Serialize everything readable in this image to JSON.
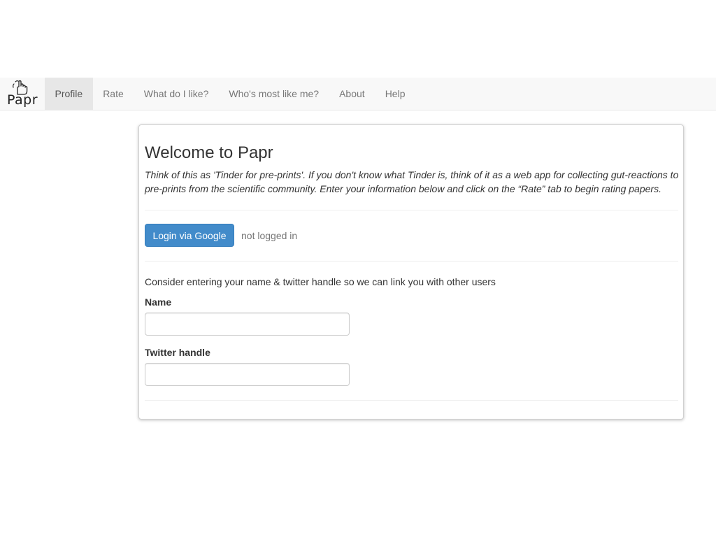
{
  "navbar": {
    "brand": {
      "text": "Papr",
      "icon": "hand-pointer-icon"
    },
    "items": [
      {
        "label": "Profile",
        "active": true
      },
      {
        "label": "Rate",
        "active": false
      },
      {
        "label": "What do I like?",
        "active": false
      },
      {
        "label": "Who's most like me?",
        "active": false
      },
      {
        "label": "About",
        "active": false
      },
      {
        "label": "Help",
        "active": false
      }
    ]
  },
  "main": {
    "title": "Welcome to Papr",
    "intro": "Think of this as 'Tinder for pre-prints'. If you don't know what Tinder is, think of it as a web app for collecting gut-reactions to pre-prints from the scientific community. Enter your information below and click on the “Rate” tab to begin rating papers.",
    "login_button": "Login via Google",
    "login_status": "not logged in",
    "consider_text": "Consider entering your name & twitter handle so we can link you with other users",
    "name_field": {
      "label": "Name",
      "value": "",
      "placeholder": ""
    },
    "twitter_field": {
      "label": "Twitter handle",
      "value": "",
      "placeholder": ""
    }
  },
  "colors": {
    "accent": "#428bca",
    "navbar_bg": "#f8f8f8",
    "nav_active_bg": "#e7e7e7"
  }
}
